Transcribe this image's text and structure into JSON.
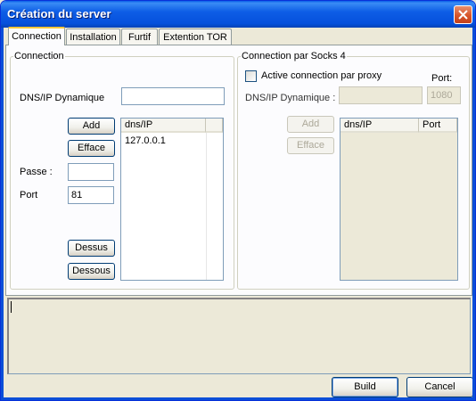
{
  "window": {
    "title": "Création du server"
  },
  "tabs": [
    {
      "label": "Connection",
      "active": true
    },
    {
      "label": "Installation",
      "active": false
    },
    {
      "label": "Furtif",
      "active": false
    },
    {
      "label": "Extention TOR",
      "active": false
    }
  ],
  "connection_group": {
    "label": "Connection",
    "dns_label": "DNS/IP Dynamique",
    "dns_value": "",
    "add_label": "Add",
    "efface_label": "Efface",
    "passe_label": "Passe :",
    "passe_value": "",
    "port_label": "Port",
    "port_value": "81",
    "dessus_label": "Dessus",
    "dessous_label": "Dessous",
    "list": {
      "headers": [
        "dns/IP",
        ""
      ],
      "rows": [
        "127.0.0.1"
      ]
    }
  },
  "socks_group": {
    "label": "Connection par Socks 4",
    "checkbox_label": "Active connection par proxy",
    "checkbox_checked": false,
    "port_label": "Port:",
    "port_value": "1080",
    "dns_label": "DNS/IP Dynamique :",
    "dns_value": "",
    "add_label": "Add",
    "efface_label": "Efface",
    "list": {
      "headers": [
        "dns/IP",
        "Port"
      ],
      "rows": []
    }
  },
  "log": {
    "text": ""
  },
  "footer": {
    "build_label": "Build",
    "cancel_label": "Cancel"
  },
  "colors": {
    "title_bar": "#0550dc",
    "close_button": "#d8552a",
    "tab_highlight": "#ffc83c"
  }
}
